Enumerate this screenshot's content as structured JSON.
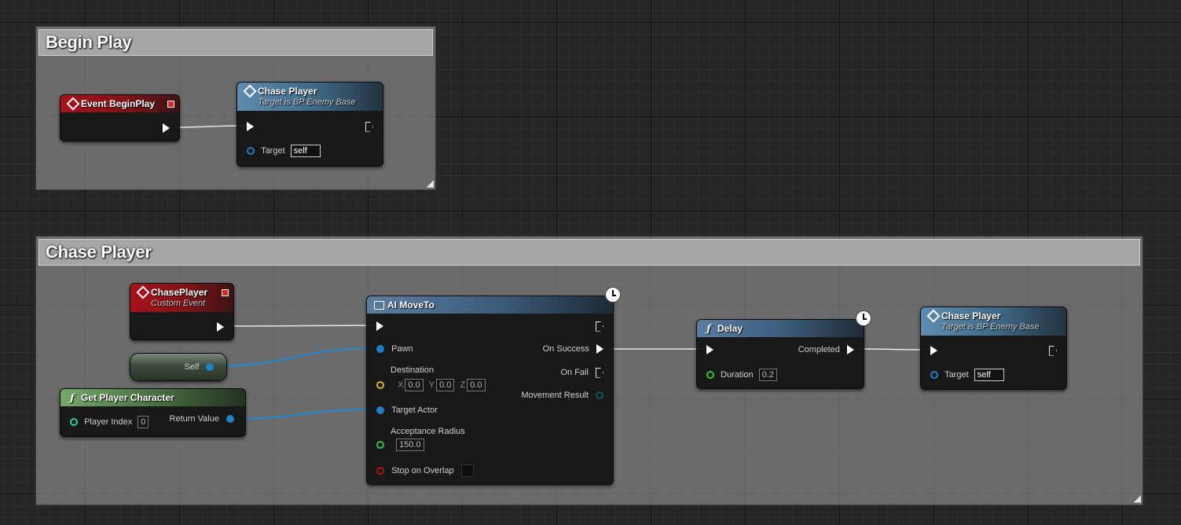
{
  "comments": {
    "begin_play": "Begin Play",
    "chase_player": "Chase Player"
  },
  "nodes": {
    "event_begin_play": {
      "title": "Event BeginPlay"
    },
    "chase_player_call_1": {
      "title": "Chase Player",
      "subtitle": "Target is BP Enemy Base",
      "target_label": "Target",
      "target_value": "self"
    },
    "chase_player_event": {
      "title": "ChasePlayer",
      "subtitle": "Custom Event"
    },
    "self_ref": {
      "label": "Self"
    },
    "get_player_character": {
      "title": "Get Player Character",
      "player_index_label": "Player Index",
      "player_index_value": "0",
      "return_label": "Return Value"
    },
    "ai_move_to": {
      "title": "AI MoveTo",
      "pawn_label": "Pawn",
      "destination_label": "Destination",
      "dest_x_label": "X",
      "dest_x": "0.0",
      "dest_y_label": "Y",
      "dest_y": "0.0",
      "dest_z_label": "Z",
      "dest_z": "0.0",
      "target_actor_label": "Target Actor",
      "acceptance_radius_label": "Acceptance Radius",
      "acceptance_radius_value": "150.0",
      "stop_on_overlap_label": "Stop on Overlap",
      "on_success_label": "On Success",
      "on_fail_label": "On Fail",
      "movement_result_label": "Movement Result"
    },
    "delay": {
      "title": "Delay",
      "completed_label": "Completed",
      "duration_label": "Duration",
      "duration_value": "0.2"
    },
    "chase_player_call_2": {
      "title": "Chase Player",
      "subtitle": "Target is BP Enemy Base",
      "target_label": "Target",
      "target_value": "self"
    }
  },
  "icons": {
    "event": "event-diamond-icon",
    "function": "function-icon",
    "latent": "clock-icon",
    "delegate": "delegate-pin-icon"
  },
  "colors": {
    "event_header": "#a8121a",
    "function_header": "#5f8cb0",
    "pure_header": "#76a86a",
    "object_pin": "#1e7fc4",
    "vector_pin": "#e0b020",
    "float_pin": "#39c13d",
    "int_pin": "#1fd0a0",
    "bool_pin": "#a41515",
    "exec_wire": "#e8e8e8"
  }
}
